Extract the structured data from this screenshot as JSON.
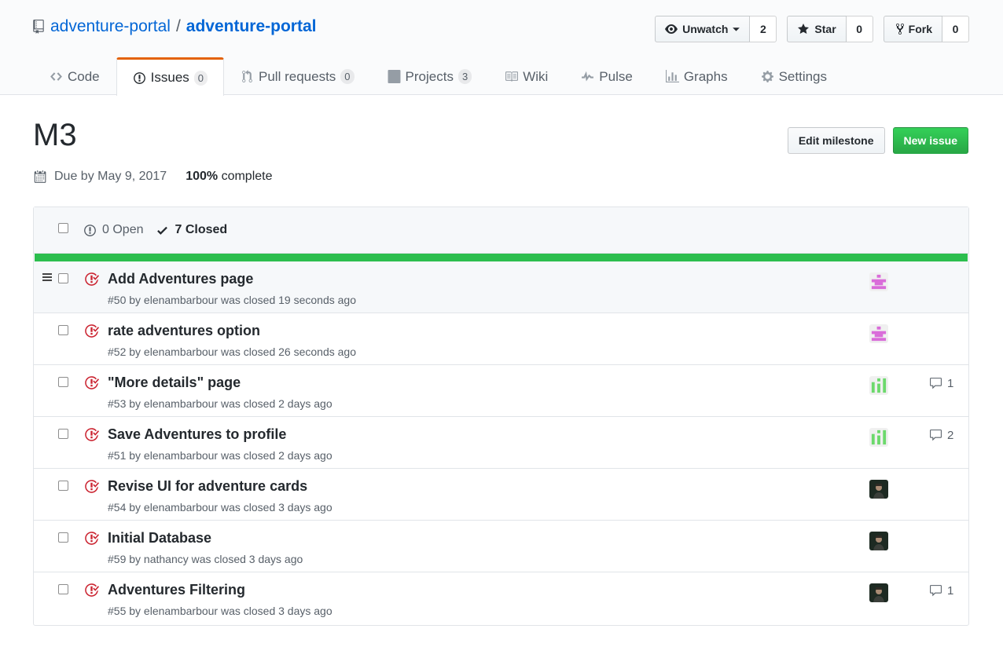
{
  "repo": {
    "owner": "adventure-portal",
    "separator": "/",
    "name": "adventure-portal"
  },
  "actions": {
    "watch_label": "Unwatch",
    "watch_count": "2",
    "star_label": "Star",
    "star_count": "0",
    "fork_label": "Fork",
    "fork_count": "0"
  },
  "nav": {
    "code": "Code",
    "issues": "Issues",
    "issues_count": "0",
    "pulls": "Pull requests",
    "pulls_count": "0",
    "projects": "Projects",
    "projects_count": "3",
    "wiki": "Wiki",
    "pulse": "Pulse",
    "graphs": "Graphs",
    "settings": "Settings"
  },
  "milestone": {
    "title": "M3",
    "edit_label": "Edit milestone",
    "new_issue_label": "New issue",
    "due": "Due by May 9, 2017",
    "percent": "100%",
    "complete_label": "complete",
    "progress_fraction": 1.0
  },
  "states": {
    "open": "0 Open",
    "closed": "7 Closed"
  },
  "colors": {
    "link": "#0366d6",
    "progress": "#2cbe4e",
    "closed_icon": "#cb2431",
    "primary_button": "#28a745",
    "nav_active": "#e36209"
  },
  "issues": [
    {
      "title": "Add Adventures page",
      "meta": "#50 by elenambarbour was closed 19 seconds ago",
      "avatar": "identicon-pink",
      "comments": ""
    },
    {
      "title": "rate adventures option",
      "meta": "#52 by elenambarbour was closed 26 seconds ago",
      "avatar": "identicon-pink",
      "comments": ""
    },
    {
      "title": "\"More details\" page",
      "meta": "#53 by elenambarbour was closed 2 days ago",
      "avatar": "identicon-green",
      "comments": "1"
    },
    {
      "title": "Save Adventures to profile",
      "meta": "#51 by elenambarbour was closed 2 days ago",
      "avatar": "identicon-green",
      "comments": "2"
    },
    {
      "title": "Revise UI for adventure cards",
      "meta": "#54 by elenambarbour was closed 3 days ago",
      "avatar": "photo-avatar",
      "comments": ""
    },
    {
      "title": "Initial Database",
      "meta": "#59 by nathancy was closed 3 days ago",
      "avatar": "photo-avatar",
      "comments": ""
    },
    {
      "title": "Adventures Filtering",
      "meta": "#55 by elenambarbour was closed 3 days ago",
      "avatar": "photo-avatar",
      "comments": "1"
    }
  ]
}
